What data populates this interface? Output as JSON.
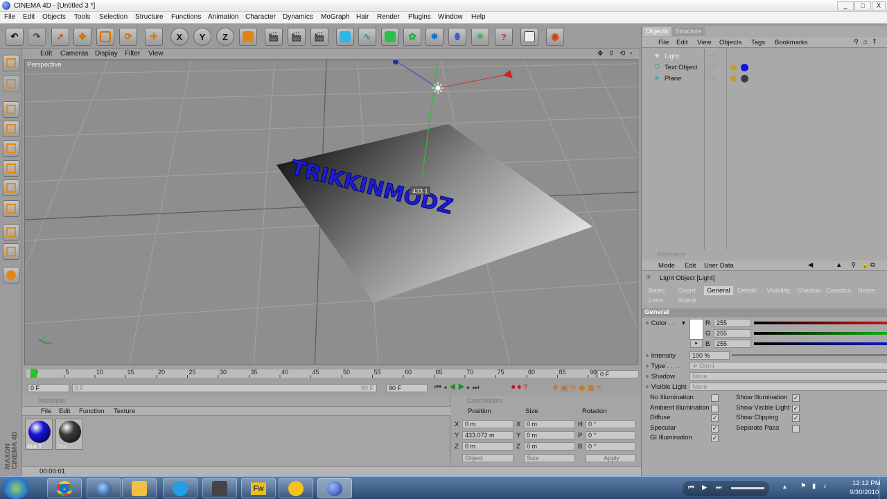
{
  "window": {
    "title": "CINEMA 4D - [Untitled 3 *]",
    "buttons": [
      "_",
      "□",
      "X"
    ]
  },
  "menu": [
    "File",
    "Edit",
    "Objects",
    "Tools",
    "Selection",
    "Structure",
    "Functions",
    "Animation",
    "Character",
    "Dynamics",
    "MoGraph",
    "Hair",
    "Render",
    "Plugins",
    "Window",
    "Help"
  ],
  "toolbar": {
    "axis_x": "X",
    "axis_y": "Y",
    "axis_z": "Z"
  },
  "viewport": {
    "menu": [
      "Edit",
      "Cameras",
      "Display",
      "Filter",
      "View"
    ],
    "label": "Perspective",
    "text_object": "TRIKKINMODZ",
    "y_readout": "433.1"
  },
  "timeline": {
    "ticks": [
      "0",
      "5",
      "10",
      "15",
      "20",
      "25",
      "30",
      "35",
      "40",
      "45",
      "50",
      "55",
      "60",
      "65",
      "70",
      "75",
      "80",
      "85",
      "90"
    ],
    "end_frame": "0 F",
    "start_field": "0 F",
    "current_field": "0 F",
    "range_end": "90 F",
    "max_field": "90 F"
  },
  "materials": {
    "title": "Materials",
    "menu": [
      "File",
      "Edit",
      "Function",
      "Texture"
    ],
    "items": [
      {
        "name": "Mat.1",
        "color": "#1414d8"
      },
      {
        "name": "Mat",
        "color": "#3c3c3c"
      }
    ]
  },
  "coordinates": {
    "title": "Coordinates",
    "headers": [
      "Position",
      "Size",
      "Rotation"
    ],
    "rows": [
      {
        "axis": "X",
        "pos": "0 m",
        "saxis": "X",
        "size": "0 m",
        "raxis": "H",
        "rot": "0 °"
      },
      {
        "axis": "Y",
        "pos": "433.072 m",
        "saxis": "Y",
        "size": "0 m",
        "raxis": "P",
        "rot": "0 °"
      },
      {
        "axis": "Z",
        "pos": "0 m",
        "saxis": "Z",
        "size": "0 m",
        "raxis": "B",
        "rot": "0 °"
      }
    ],
    "mode": "Object",
    "size_mode": "Size",
    "apply": "Apply"
  },
  "status": "00:00:01",
  "objects": {
    "tabs": [
      "Objects",
      "Structure"
    ],
    "menu": [
      "File",
      "Edit",
      "View",
      "Objects",
      "Tags",
      "Bookmarks"
    ],
    "items": [
      "Light",
      "Text Object",
      "Plane"
    ]
  },
  "attributes": {
    "title": "Attributes",
    "menu": [
      "Mode",
      "Edit",
      "User Data"
    ],
    "object": "Light Object [Light]",
    "tabs_row1": [
      "Basic",
      "Coord",
      "General",
      "Details",
      "Visibility",
      "Shadow",
      "Caustics",
      "Noise"
    ],
    "tabs_row2": [
      "Lens",
      "Scene"
    ],
    "section": "General",
    "color_label": "Color",
    "rgb": [
      {
        "ch": "R",
        "val": "255",
        "color": "#d01010"
      },
      {
        "ch": "G",
        "val": "255",
        "color": "#10b010"
      },
      {
        "ch": "B",
        "val": "255",
        "color": "#1018c0"
      }
    ],
    "intensity_label": "Intensity",
    "intensity": "100 %",
    "type_label": "Type",
    "type": "Omni",
    "shadow_label": "Shadow",
    "shadow": "None",
    "visible_label": "Visible Light",
    "visible": "None",
    "left_checks": [
      {
        "label": "No Illumination",
        "checked": false
      },
      {
        "label": "Ambient Illumination",
        "checked": false
      },
      {
        "label": "Diffuse",
        "checked": true
      },
      {
        "label": "Specular",
        "checked": true
      },
      {
        "label": "GI Illumination",
        "checked": true
      }
    ],
    "right_checks": [
      {
        "label": "Show Illumination",
        "checked": true
      },
      {
        "label": "Show Visible Light",
        "checked": true
      },
      {
        "label": "Show Clipping",
        "checked": true
      },
      {
        "label": "Separate Pass",
        "checked": false
      }
    ]
  },
  "taskbar": {
    "time": "12:12 PM",
    "date": "9/30/2010",
    "fw_label": "Fw"
  }
}
